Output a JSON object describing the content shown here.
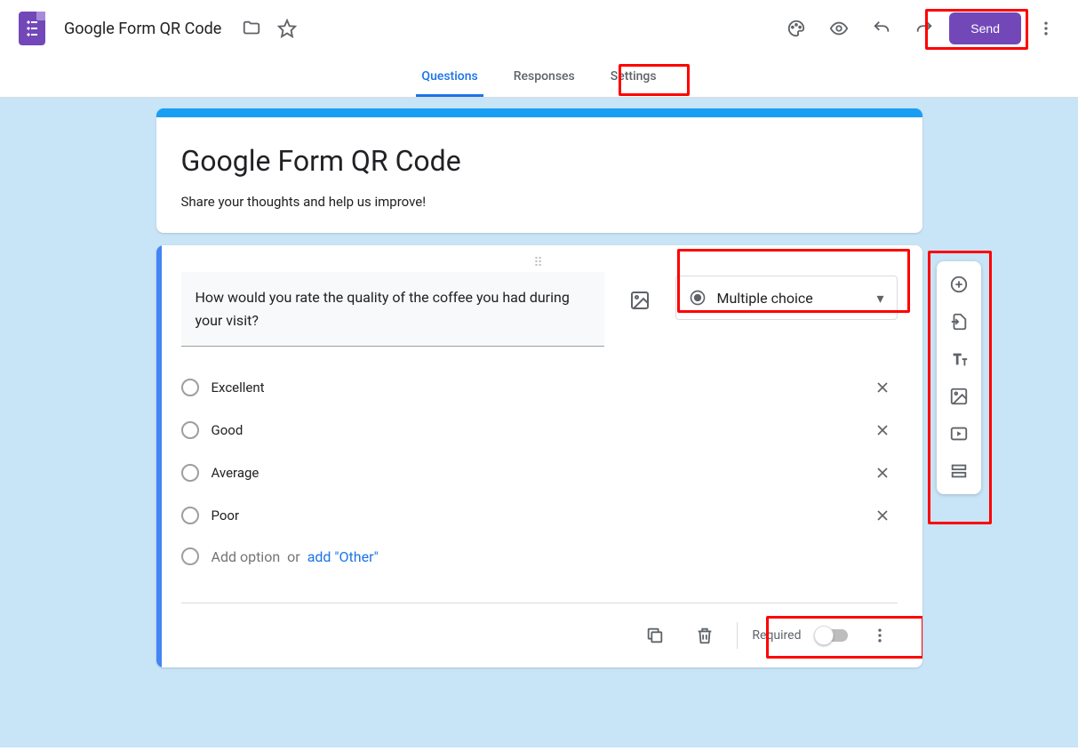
{
  "header": {
    "doc_title": "Google Form QR Code",
    "send_label": "Send"
  },
  "tabs": {
    "questions": "Questions",
    "responses": "Responses",
    "settings": "Settings"
  },
  "form": {
    "title": "Google Form QR Code",
    "description": "Share your thoughts and help us improve!"
  },
  "question": {
    "text": "How would you rate the quality of the coffee you had during your visit?",
    "type_label": "Multiple choice",
    "options": [
      "Excellent",
      "Good",
      "Average",
      "Poor"
    ],
    "add_option": "Add option",
    "or": "or",
    "add_other": "add \"Other\"",
    "required_label": "Required"
  }
}
